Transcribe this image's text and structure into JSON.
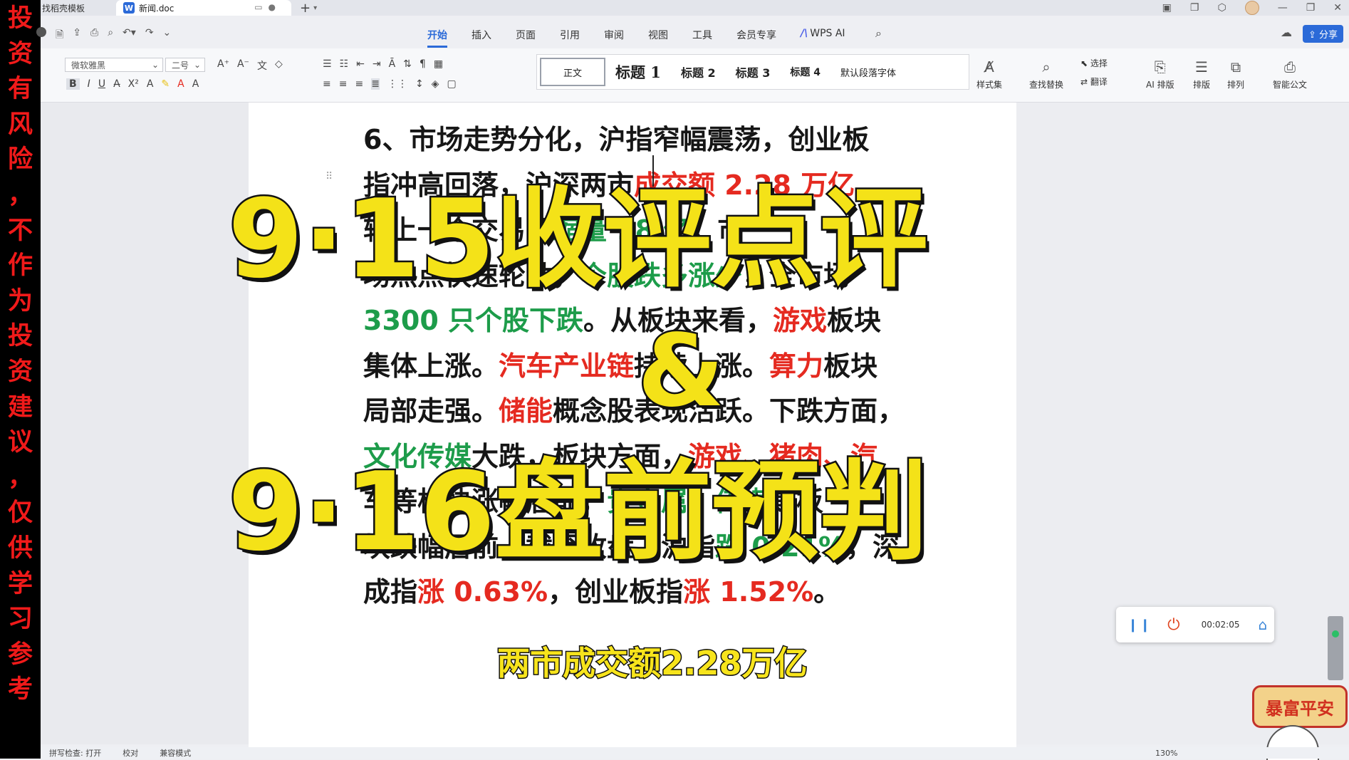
{
  "banner": {
    "chars": [
      "投",
      "资",
      "有",
      "风",
      "险",
      "，",
      "不",
      "作",
      "为",
      "投",
      "资",
      "建",
      "议",
      "，",
      "仅",
      "供",
      "学",
      "习",
      "参",
      "考"
    ]
  },
  "tabs": {
    "prev_label": "找稻壳模板",
    "active_label": "新闻.doc",
    "active_icon": "W",
    "new_tab": "+"
  },
  "menu": {
    "items": [
      "开始",
      "插入",
      "页面",
      "引用",
      "审阅",
      "视图",
      "工具",
      "会员专享"
    ],
    "active_index": 0,
    "wps_ai": "WPS AI",
    "share": "分享"
  },
  "ribbon": {
    "font_name": "微软雅黑",
    "font_size": "二号",
    "styles": [
      "正文",
      "标题 1",
      "标题 2",
      "标题 3",
      "标题 4",
      "默认段落字体"
    ],
    "style_set": "样式集",
    "find_replace": "查找替换",
    "select": "选择",
    "translate": "翻译",
    "ai_layout": "AI 排版",
    "layout": "排版",
    "arrange": "排列",
    "smart_doc": "智能公文"
  },
  "document": {
    "lines": [
      [
        {
          "t": "6、市场走势分化，沪指窄幅震荡，创业板",
          "c": "k"
        }
      ],
      [
        {
          "t": "指冲高回落，沪深两市",
          "c": "k"
        },
        {
          "t": "成交额 2.28 万亿",
          "c": "r"
        },
        {
          "t": "，",
          "c": "k"
        }
      ],
      [
        {
          "t": "较上一个交易日",
          "c": "k"
        },
        {
          "t": "缩量 18 亿",
          "c": "g"
        },
        {
          "t": "。市",
          "c": "k"
        }
      ],
      [
        {
          "t": "场热点快速轮动，",
          "c": "k"
        },
        {
          "t": "个股跌多涨少",
          "c": "g"
        },
        {
          "t": "，全市场",
          "c": "k"
        }
      ],
      [
        {
          "t": "3300 只个股下跌",
          "c": "g"
        },
        {
          "t": "。从板块来看，",
          "c": "k"
        },
        {
          "t": "游戏",
          "c": "r"
        },
        {
          "t": "板块",
          "c": "k"
        }
      ],
      [
        {
          "t": "集体上涨。",
          "c": "k"
        },
        {
          "t": "汽车产业链",
          "c": "r"
        },
        {
          "t": "持续上涨。",
          "c": "k"
        },
        {
          "t": "算力",
          "c": "r"
        },
        {
          "t": "板块",
          "c": "k"
        }
      ],
      [
        {
          "t": "局部走强。",
          "c": "k"
        },
        {
          "t": "储能",
          "c": "r"
        },
        {
          "t": "概念股表现活跃。下跌方面，",
          "c": "k"
        }
      ],
      [
        {
          "t": "文化传媒",
          "c": "g"
        },
        {
          "t": "大跌，板块方面，",
          "c": "k"
        },
        {
          "t": "游戏、猪肉、汽",
          "c": "r"
        }
      ],
      [
        {
          "t": "车等板块涨幅居前，",
          "c": "k"
        },
        {
          "t": "贵金属、传媒",
          "c": "g"
        },
        {
          "t": "等板",
          "c": "k"
        }
      ],
      [
        {
          "t": "块跌幅居前。截至收盘，沪指",
          "c": "k"
        },
        {
          "t": "跌 0.21%",
          "c": "g"
        },
        {
          "t": "，深",
          "c": "k"
        }
      ],
      [
        {
          "t": "成指",
          "c": "k"
        },
        {
          "t": "涨 0.63%",
          "c": "r"
        },
        {
          "t": "，创业板指",
          "c": "k"
        },
        {
          "t": "涨 1.52%",
          "c": "r"
        },
        {
          "t": "。",
          "c": "k"
        }
      ]
    ]
  },
  "overlay": {
    "title1": "9·15收评点评",
    "amp": "&",
    "title2": "9·16盘前预判",
    "subtitle": "两市成交额2.28万亿"
  },
  "recorder": {
    "time": "00:02:05"
  },
  "sticker": {
    "text": "暴富平安"
  },
  "status": {
    "spell": "拼写检查: 打开",
    "proof": "校对",
    "compat": "兼容模式",
    "zoom": "130%"
  },
  "colors": {
    "red": "#e52a20",
    "green": "#1d9c4a",
    "accent": "#2b6ad8",
    "overlay_yellow": "#f4e218"
  }
}
